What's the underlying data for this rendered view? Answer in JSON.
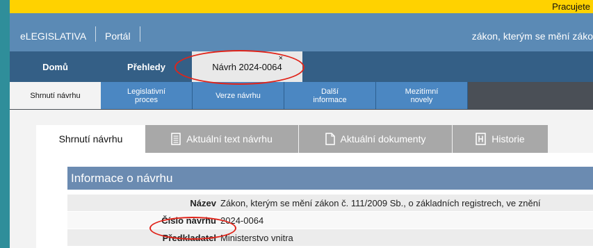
{
  "banner": {
    "text": "Pracujete"
  },
  "appbar": {
    "app_title": "eLEGISLATIVA",
    "portal": "Portál",
    "doc_title": "zákon, kterým se mění záko"
  },
  "main_tabs": [
    {
      "label": "Domů"
    },
    {
      "label": "Přehledy"
    },
    {
      "label": "Návrh 2024-0064",
      "close": "×"
    }
  ],
  "sub_tabs": [
    {
      "label": "Shrnutí návrhu"
    },
    {
      "label": "Legislativní\nproces"
    },
    {
      "label": "Verze návrhu"
    },
    {
      "label": "Další\ninformace"
    },
    {
      "label": "Mezitímní\nnovely"
    }
  ],
  "section_tabs": [
    {
      "label": "Shrnutí návrhu"
    },
    {
      "label": "Aktuální text návrhu",
      "icon": "document-lines-icon"
    },
    {
      "label": "Aktuální dokumenty",
      "icon": "page-icon"
    },
    {
      "label": "Historie",
      "icon": "history-h-icon"
    }
  ],
  "info": {
    "header": "Informace o návrhu",
    "rows": [
      {
        "label": "Název",
        "value": "Zákon, kterým se mění zákon č. 111/2009 Sb., o základních registrech, ve znění"
      },
      {
        "label": "Číslo návrhu",
        "value": "2024-0064"
      },
      {
        "label": "Předkladatel",
        "value": "Ministerstvo vnitra"
      }
    ]
  },
  "colors": {
    "banner": "#ffd200",
    "appbar": "#5b8ab5",
    "nav": "#345f86",
    "subnav": "#4b87c2",
    "annotation": "#e0241a"
  }
}
